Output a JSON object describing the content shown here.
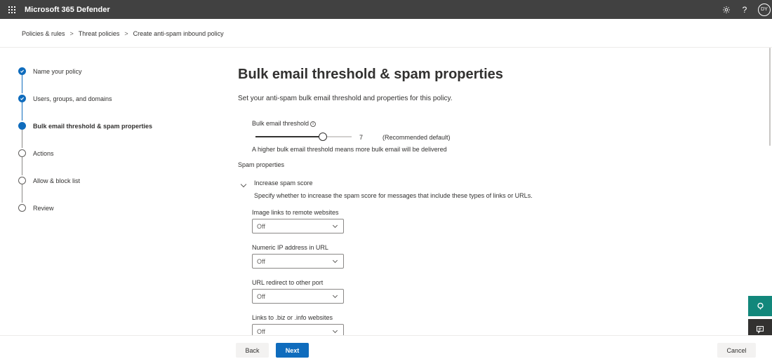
{
  "header": {
    "app_title": "Microsoft 365 Defender",
    "help_label": "?",
    "avatar_initials": "DY"
  },
  "breadcrumb": {
    "items": [
      "Policies & rules",
      "Threat policies",
      "Create anti-spam inbound policy"
    ],
    "separator": ">"
  },
  "steps": [
    {
      "label": "Name your policy",
      "state": "done"
    },
    {
      "label": "Users, groups, and domains",
      "state": "done"
    },
    {
      "label": "Bulk email threshold & spam properties",
      "state": "current"
    },
    {
      "label": "Actions",
      "state": "todo"
    },
    {
      "label": "Allow & block list",
      "state": "todo"
    },
    {
      "label": "Review",
      "state": "todo"
    }
  ],
  "main": {
    "title": "Bulk email threshold & spam properties",
    "subtitle": "Set your anti-spam bulk email threshold and properties for this policy.",
    "bulk_threshold": {
      "label": "Bulk email threshold",
      "info_glyph": "i",
      "value": "7",
      "fraction": 0.7,
      "recommended": "(Recommended default)",
      "hint": "A higher bulk email threshold means more bulk email will be delivered"
    },
    "spam_properties_heading": "Spam properties",
    "increase_spam_score": {
      "heading": "Increase spam score",
      "description": "Specify whether to increase the spam score for messages that include these types of links or URLs."
    },
    "fields": [
      {
        "label": "Image links to remote websites",
        "value": "Off"
      },
      {
        "label": "Numeric IP address in URL",
        "value": "Off"
      },
      {
        "label": "URL redirect to other port",
        "value": "Off"
      },
      {
        "label": "Links to .biz or .info websites",
        "value": "Off"
      }
    ]
  },
  "footer": {
    "back_label": "Back",
    "next_label": "Next",
    "cancel_label": "Cancel"
  },
  "colors": {
    "accent": "#0f6cbd",
    "topbar": "#414141",
    "help_button": "#12877b"
  }
}
